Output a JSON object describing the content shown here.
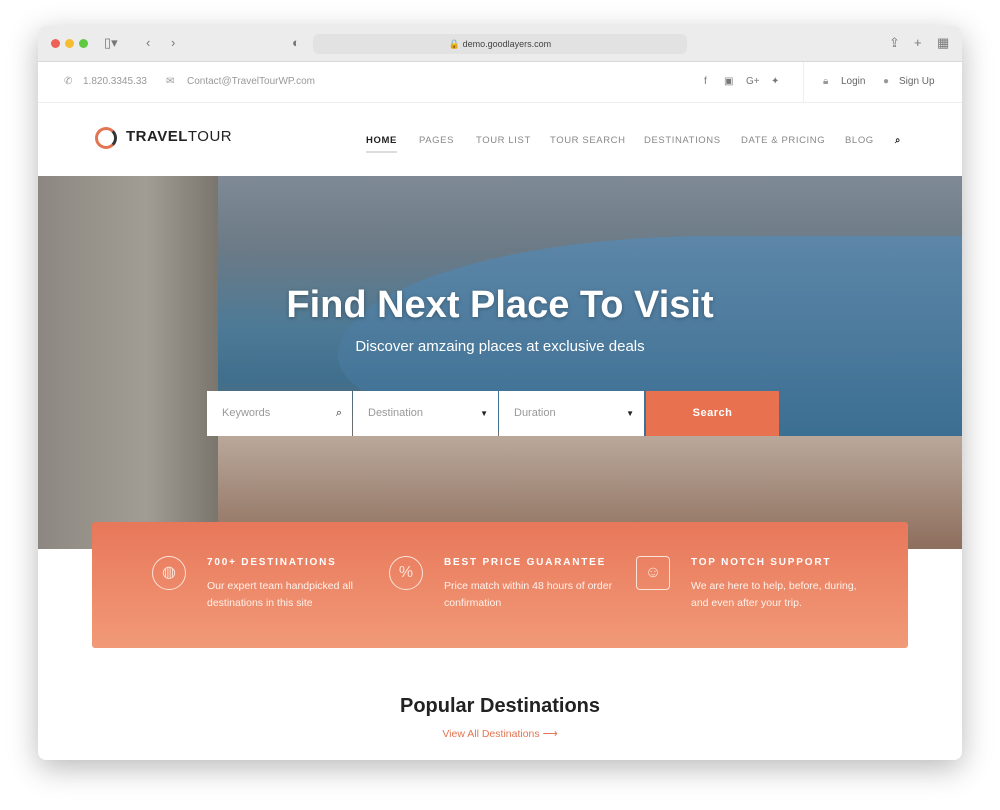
{
  "browser": {
    "url": "demo.goodlayers.com"
  },
  "topbar": {
    "phone": "1.820.3345.33",
    "email": "Contact@TravelTourWP.com",
    "social": [
      "f",
      "▣",
      "G+",
      "🐦"
    ],
    "login": "Login",
    "signup": "Sign Up"
  },
  "nav": {
    "logo_bold": "TRAVEL",
    "logo_light": "TOUR",
    "items": [
      "HOME",
      "PAGES",
      "TOUR LIST",
      "TOUR SEARCH",
      "DESTINATIONS",
      "DATE & PRICING",
      "BLOG"
    ],
    "active": "HOME"
  },
  "hero": {
    "title": "Find Next Place To Visit",
    "subtitle": "Discover amzaing places at exclusive deals",
    "search": {
      "keywords_placeholder": "Keywords",
      "destination": "Destination",
      "duration": "Duration",
      "button": "Search"
    }
  },
  "features": [
    {
      "icon": "globe-icon",
      "title": "700+ DESTINATIONS",
      "text": "Our expert team handpicked all destinations in this site"
    },
    {
      "icon": "percent-badge-icon",
      "title": "BEST PRICE GUARANTEE",
      "text": "Price match within 48 hours of order confirmation"
    },
    {
      "icon": "support-people-icon",
      "title": "TOP NOTCH SUPPORT",
      "text": "We are here to help, before, during, and even after your trip."
    }
  ],
  "popular": {
    "title": "Popular Destinations",
    "link": "View All Destinations"
  },
  "colors": {
    "accent": "#e8714f"
  }
}
